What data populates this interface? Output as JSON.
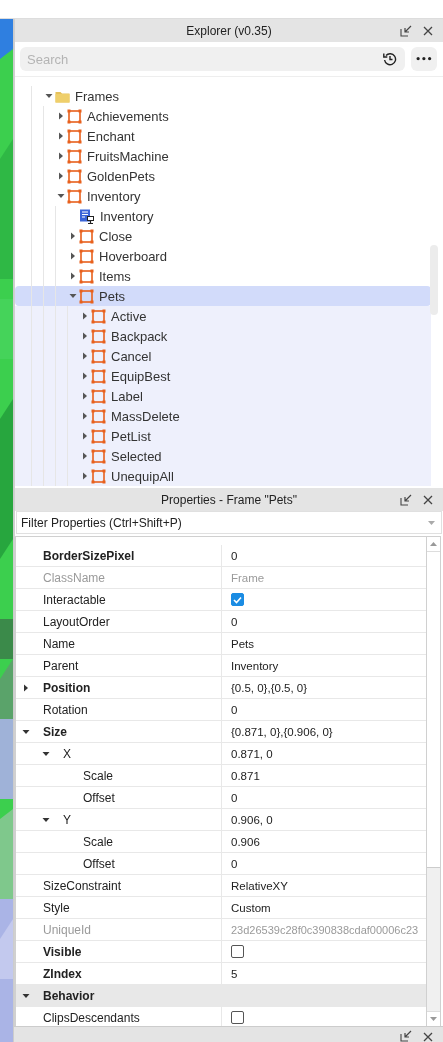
{
  "explorer": {
    "title": "Explorer (v0.35)",
    "search": {
      "placeholder": "Search"
    },
    "more_button": "•••",
    "tree": [
      {
        "label": "Frames",
        "kind": "folder",
        "expanded": true,
        "selected": false,
        "children": [
          {
            "label": "Achievements",
            "kind": "frame",
            "expanded": false,
            "selected": false
          },
          {
            "label": "Enchant",
            "kind": "frame",
            "expanded": false,
            "selected": false
          },
          {
            "label": "FruitsMachine",
            "kind": "frame",
            "expanded": false,
            "selected": false
          },
          {
            "label": "GoldenPets",
            "kind": "frame",
            "expanded": false,
            "selected": false
          },
          {
            "label": "Inventory",
            "kind": "frame",
            "expanded": true,
            "selected": false,
            "children": [
              {
                "label": "Inventory",
                "kind": "script",
                "selected": false
              },
              {
                "label": "Close",
                "kind": "frame",
                "expanded": false,
                "selected": false
              },
              {
                "label": "Hoverboard",
                "kind": "frame",
                "expanded": false,
                "selected": false
              },
              {
                "label": "Items",
                "kind": "frame",
                "expanded": false,
                "selected": false
              },
              {
                "label": "Pets",
                "kind": "frame",
                "expanded": true,
                "selected": true,
                "children": [
                  {
                    "label": "Active",
                    "kind": "frame",
                    "expanded": false,
                    "selected": false
                  },
                  {
                    "label": "Backpack",
                    "kind": "frame",
                    "expanded": false,
                    "selected": false
                  },
                  {
                    "label": "Cancel",
                    "kind": "frame",
                    "expanded": false,
                    "selected": false
                  },
                  {
                    "label": "EquipBest",
                    "kind": "frame",
                    "expanded": false,
                    "selected": false
                  },
                  {
                    "label": "Label",
                    "kind": "frame",
                    "expanded": false,
                    "selected": false
                  },
                  {
                    "label": "MassDelete",
                    "kind": "frame",
                    "expanded": false,
                    "selected": false
                  },
                  {
                    "label": "PetList",
                    "kind": "frame",
                    "expanded": false,
                    "selected": false
                  },
                  {
                    "label": "Selected",
                    "kind": "frame",
                    "expanded": false,
                    "selected": false
                  },
                  {
                    "label": "UnequipAll",
                    "kind": "frame",
                    "expanded": false,
                    "selected": false
                  }
                ]
              }
            ]
          }
        ]
      }
    ]
  },
  "properties": {
    "title": "Properties - Frame \"Pets\"",
    "filter": {
      "placeholder": "Filter Properties (Ctrl+Shift+P)"
    },
    "rows": [
      {
        "kind": "text",
        "name": "BorderSizePixel",
        "value": "0",
        "bold": true,
        "readonly": false
      },
      {
        "kind": "text",
        "name": "ClassName",
        "value": "Frame",
        "bold": false,
        "readonly": true
      },
      {
        "kind": "checkbox",
        "name": "Interactable",
        "checked": true,
        "bold": false,
        "readonly": false
      },
      {
        "kind": "text",
        "name": "LayoutOrder",
        "value": "0",
        "bold": false,
        "readonly": false
      },
      {
        "kind": "text",
        "name": "Name",
        "value": "Pets",
        "bold": false,
        "readonly": false
      },
      {
        "kind": "text",
        "name": "Parent",
        "value": "Inventory",
        "bold": false,
        "readonly": false
      },
      {
        "kind": "text",
        "name": "Position",
        "value": "{0.5, 0},{0.5, 0}",
        "bold": true,
        "readonly": false,
        "expanded": false
      },
      {
        "kind": "text",
        "name": "Rotation",
        "value": "0",
        "bold": false,
        "readonly": false
      },
      {
        "kind": "text",
        "name": "Size",
        "value": "{0.871, 0},{0.906, 0}",
        "bold": true,
        "readonly": false,
        "expanded": true,
        "children": [
          {
            "kind": "text",
            "name": "X",
            "value": "0.871, 0",
            "bold": false,
            "readonly": false,
            "expanded": true,
            "children": [
              {
                "kind": "text",
                "name": "Scale",
                "value": "0.871",
                "bold": false,
                "readonly": false
              },
              {
                "kind": "text",
                "name": "Offset",
                "value": "0",
                "bold": false,
                "readonly": false
              }
            ]
          },
          {
            "kind": "text",
            "name": "Y",
            "value": "0.906, 0",
            "bold": false,
            "readonly": false,
            "expanded": true,
            "children": [
              {
                "kind": "text",
                "name": "Scale",
                "value": "0.906",
                "bold": false,
                "readonly": false
              },
              {
                "kind": "text",
                "name": "Offset",
                "value": "0",
                "bold": false,
                "readonly": false
              }
            ]
          }
        ]
      },
      {
        "kind": "text",
        "name": "SizeConstraint",
        "value": "RelativeXY",
        "bold": false,
        "readonly": false
      },
      {
        "kind": "text",
        "name": "Style",
        "value": "Custom",
        "bold": false,
        "readonly": false
      },
      {
        "kind": "text",
        "name": "UniqueId",
        "value": "23d26539c28f0c390838cdaf00006c23",
        "bold": false,
        "readonly": true
      },
      {
        "kind": "checkbox",
        "name": "Visible",
        "checked": false,
        "bold": true,
        "readonly": false
      },
      {
        "kind": "text",
        "name": "ZIndex",
        "value": "5",
        "bold": true,
        "readonly": false
      },
      {
        "kind": "category",
        "name": "Behavior",
        "expanded": true
      },
      {
        "kind": "checkbox",
        "name": "ClipsDescendants",
        "checked": false,
        "bold": false,
        "readonly": false
      }
    ]
  }
}
